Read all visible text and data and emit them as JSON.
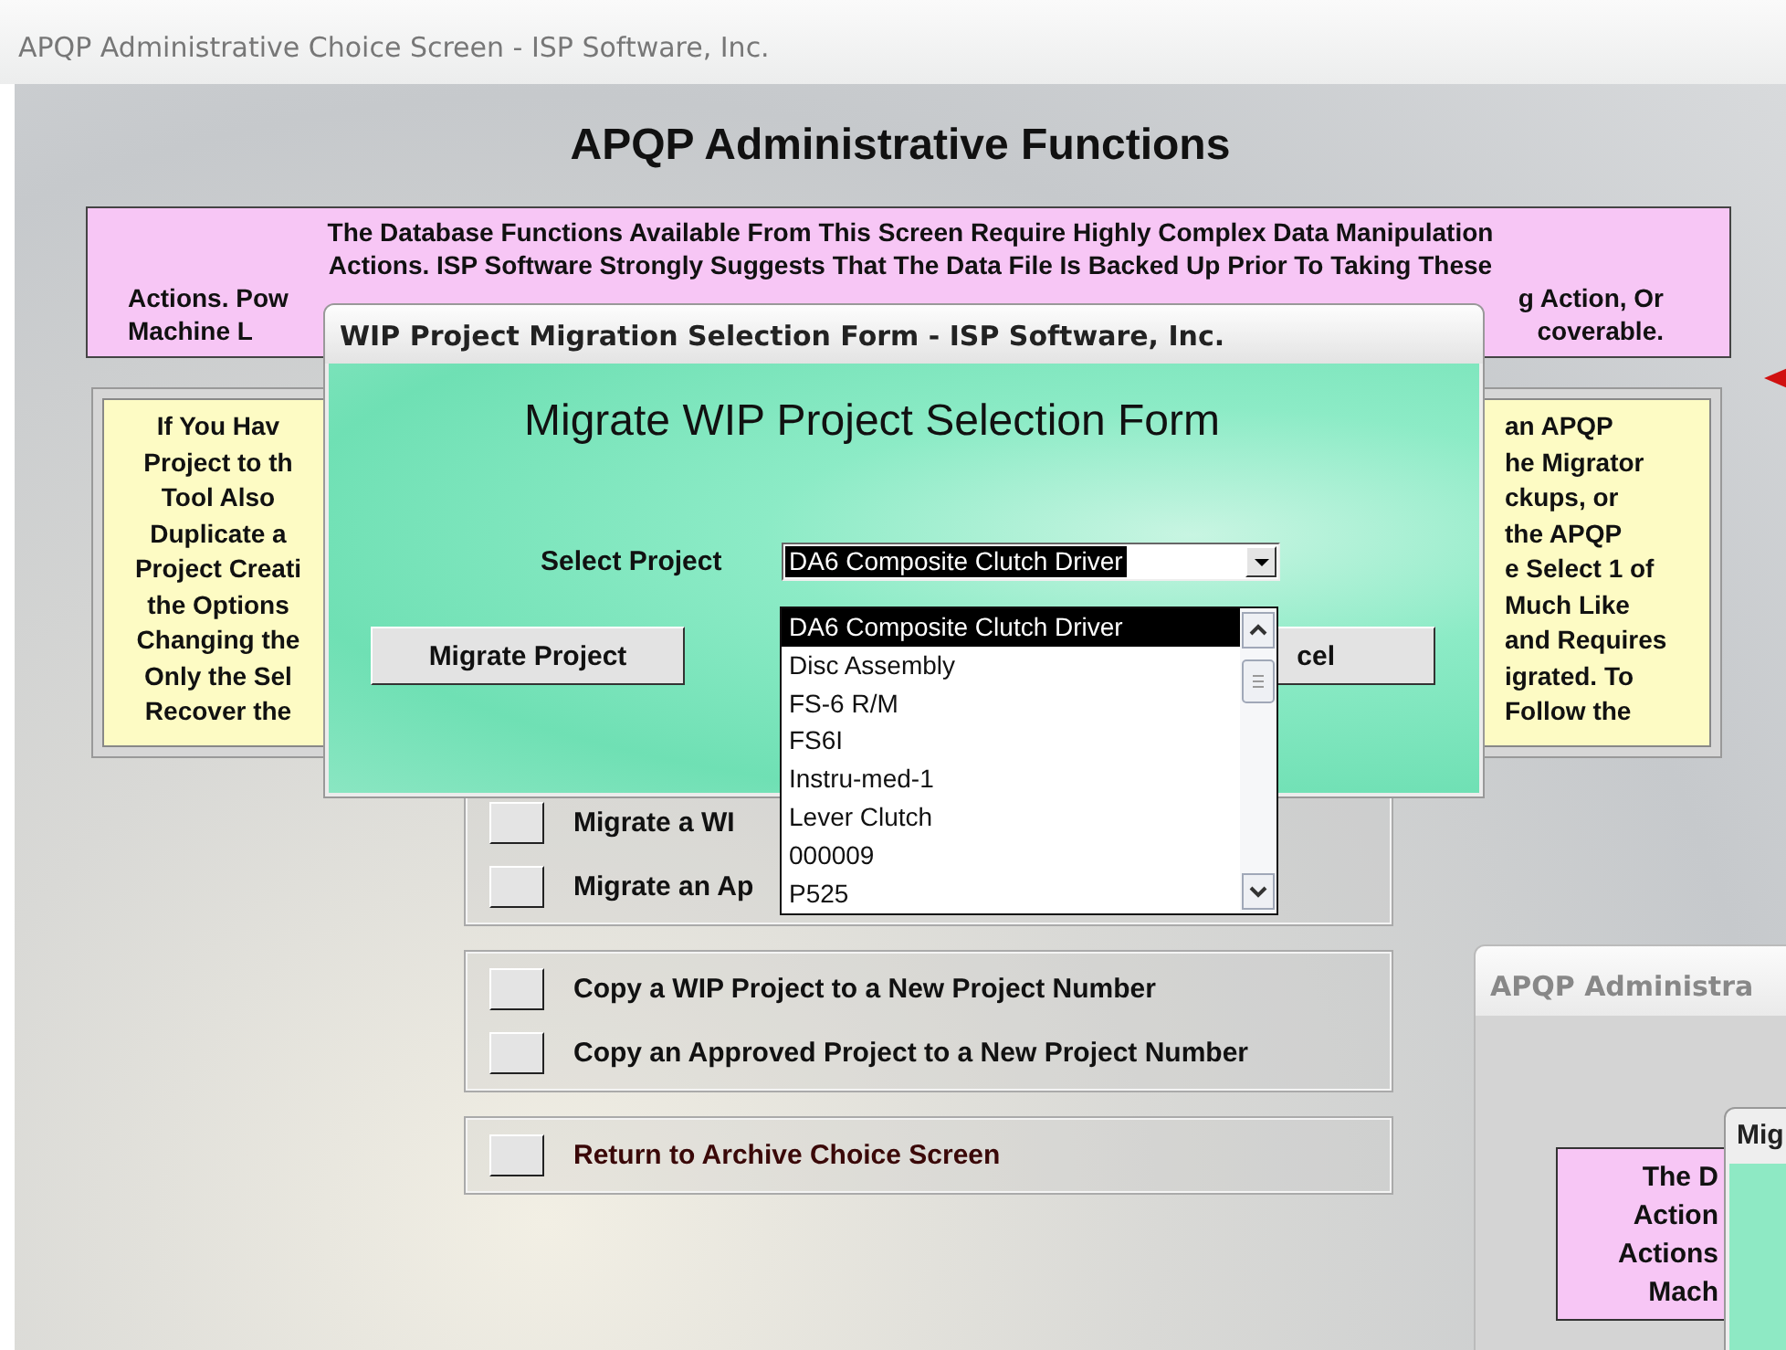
{
  "main_window": {
    "title": "APQP Administrative Choice Screen - ISP Software, Inc.",
    "heading": "APQP Administrative Functions",
    "warning_lines": [
      {
        "parts": [
          "The Database Functions Available From This Screen Require Highly Complex Data Manipulation"
        ]
      },
      {
        "parts": [
          "Actions. ISP Software Strongly Suggests That The Data File Is Backed Up Prior To Taking These"
        ]
      },
      {
        "parts": [
          "Actions. Pow",
          "g Action, Or"
        ]
      },
      {
        "parts": [
          "Machine L",
          "coverable."
        ]
      }
    ],
    "info_left": [
      "If You Hav",
      "Project to th",
      "Tool Also",
      "Duplicate a",
      "Project Creati",
      "the Options",
      "Changing the",
      "Only the Sel",
      "Recover the"
    ],
    "info_right": [
      "an APQP",
      "he Migrator",
      "ckups, or",
      "the APQP",
      "e Select 1 of",
      "Much Like",
      "and Requires",
      "igrated. To",
      "Follow the"
    ],
    "option_groups": [
      {
        "options": [
          {
            "label": "Migrate a WI",
            "kind": "normal"
          },
          {
            "label": "Migrate an Ap",
            "kind": "normal"
          }
        ]
      },
      {
        "options": [
          {
            "label": "Copy a WIP Project to a New Project Number",
            "kind": "normal"
          },
          {
            "label": "Copy an Approved Project to a New Project Number",
            "kind": "normal"
          }
        ]
      },
      {
        "options": [
          {
            "label": "Return to Archive Choice Screen",
            "kind": "exit"
          }
        ]
      }
    ]
  },
  "dialog": {
    "title": "WIP Project Migration Selection Form - ISP Software, Inc.",
    "heading": "Migrate WIP Project Selection Form",
    "select_label": "Select Project",
    "select_value": "DA6 Composite Clutch Driver",
    "list_items": [
      {
        "label": "DA6 Composite Clutch Driver",
        "selected": true
      },
      {
        "label": "Disc Assembly",
        "selected": false
      },
      {
        "label": "FS-6 R/M",
        "selected": false
      },
      {
        "label": "FS6I",
        "selected": false
      },
      {
        "label": "Instru-med-1",
        "selected": false
      },
      {
        "label": "Lever Clutch",
        "selected": false
      },
      {
        "label": "000009",
        "selected": false
      },
      {
        "label": "P525",
        "selected": false
      }
    ],
    "buttons": [
      "Migrate Project",
      "cel"
    ]
  },
  "inset_window": {
    "title": "APQP Administra",
    "dialog_title": "Mig",
    "warning_lines": [
      "The D",
      "Action",
      "Actions",
      "Mach"
    ]
  }
}
